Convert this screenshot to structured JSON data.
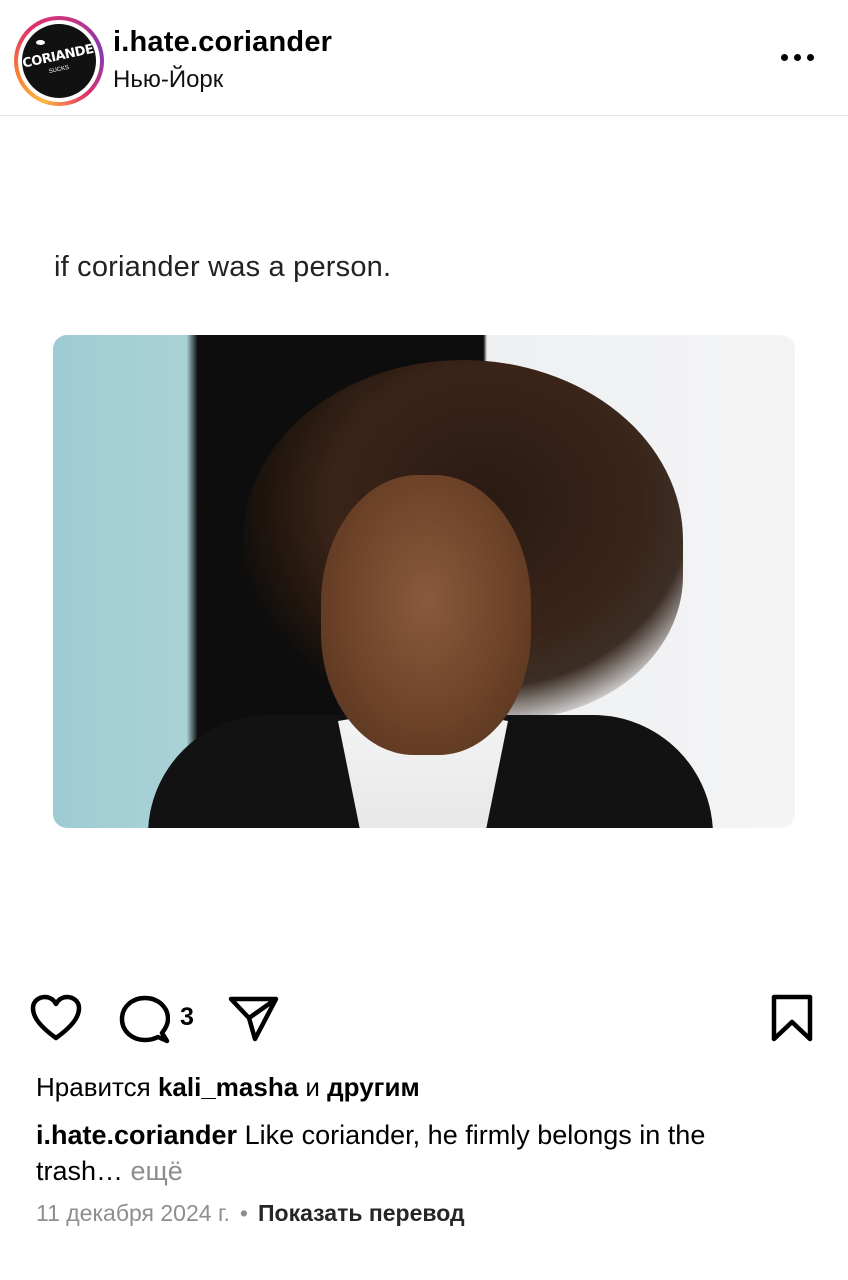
{
  "header": {
    "avatar_label": "CORIANDER",
    "avatar_sub": "SUCKS",
    "username": "i.hate.coriander",
    "location": "Нью-Йорк",
    "more_icon": "more-horizontal-icon"
  },
  "post": {
    "image_text": "if coriander was a person.",
    "comment_count": "3"
  },
  "actions": {
    "like_icon": "heart-icon",
    "comment_icon": "comment-bubble-icon",
    "share_icon": "paper-plane-icon",
    "save_icon": "bookmark-icon"
  },
  "likes": {
    "prefix": "Нравится ",
    "user": "kali_masha",
    "middle": " и ",
    "others": "другим"
  },
  "caption": {
    "username": "i.hate.coriander",
    "text": " Like coriander, he firmly belongs in the trash…",
    "more": " ещё"
  },
  "meta": {
    "date": "11 декабря 2024 г.",
    "separator": "•",
    "translate": "Показать перевод"
  }
}
